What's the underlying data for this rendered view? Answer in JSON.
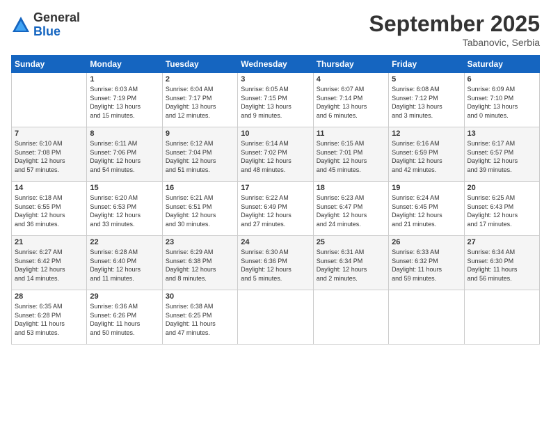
{
  "logo": {
    "general": "General",
    "blue": "Blue"
  },
  "title": "September 2025",
  "location": "Tabanovic, Serbia",
  "days_of_week": [
    "Sunday",
    "Monday",
    "Tuesday",
    "Wednesday",
    "Thursday",
    "Friday",
    "Saturday"
  ],
  "weeks": [
    [
      {
        "day": "",
        "info": ""
      },
      {
        "day": "1",
        "info": "Sunrise: 6:03 AM\nSunset: 7:19 PM\nDaylight: 13 hours\nand 15 minutes."
      },
      {
        "day": "2",
        "info": "Sunrise: 6:04 AM\nSunset: 7:17 PM\nDaylight: 13 hours\nand 12 minutes."
      },
      {
        "day": "3",
        "info": "Sunrise: 6:05 AM\nSunset: 7:15 PM\nDaylight: 13 hours\nand 9 minutes."
      },
      {
        "day": "4",
        "info": "Sunrise: 6:07 AM\nSunset: 7:14 PM\nDaylight: 13 hours\nand 6 minutes."
      },
      {
        "day": "5",
        "info": "Sunrise: 6:08 AM\nSunset: 7:12 PM\nDaylight: 13 hours\nand 3 minutes."
      },
      {
        "day": "6",
        "info": "Sunrise: 6:09 AM\nSunset: 7:10 PM\nDaylight: 13 hours\nand 0 minutes."
      }
    ],
    [
      {
        "day": "7",
        "info": "Sunrise: 6:10 AM\nSunset: 7:08 PM\nDaylight: 12 hours\nand 57 minutes."
      },
      {
        "day": "8",
        "info": "Sunrise: 6:11 AM\nSunset: 7:06 PM\nDaylight: 12 hours\nand 54 minutes."
      },
      {
        "day": "9",
        "info": "Sunrise: 6:12 AM\nSunset: 7:04 PM\nDaylight: 12 hours\nand 51 minutes."
      },
      {
        "day": "10",
        "info": "Sunrise: 6:14 AM\nSunset: 7:02 PM\nDaylight: 12 hours\nand 48 minutes."
      },
      {
        "day": "11",
        "info": "Sunrise: 6:15 AM\nSunset: 7:01 PM\nDaylight: 12 hours\nand 45 minutes."
      },
      {
        "day": "12",
        "info": "Sunrise: 6:16 AM\nSunset: 6:59 PM\nDaylight: 12 hours\nand 42 minutes."
      },
      {
        "day": "13",
        "info": "Sunrise: 6:17 AM\nSunset: 6:57 PM\nDaylight: 12 hours\nand 39 minutes."
      }
    ],
    [
      {
        "day": "14",
        "info": "Sunrise: 6:18 AM\nSunset: 6:55 PM\nDaylight: 12 hours\nand 36 minutes."
      },
      {
        "day": "15",
        "info": "Sunrise: 6:20 AM\nSunset: 6:53 PM\nDaylight: 12 hours\nand 33 minutes."
      },
      {
        "day": "16",
        "info": "Sunrise: 6:21 AM\nSunset: 6:51 PM\nDaylight: 12 hours\nand 30 minutes."
      },
      {
        "day": "17",
        "info": "Sunrise: 6:22 AM\nSunset: 6:49 PM\nDaylight: 12 hours\nand 27 minutes."
      },
      {
        "day": "18",
        "info": "Sunrise: 6:23 AM\nSunset: 6:47 PM\nDaylight: 12 hours\nand 24 minutes."
      },
      {
        "day": "19",
        "info": "Sunrise: 6:24 AM\nSunset: 6:45 PM\nDaylight: 12 hours\nand 21 minutes."
      },
      {
        "day": "20",
        "info": "Sunrise: 6:25 AM\nSunset: 6:43 PM\nDaylight: 12 hours\nand 17 minutes."
      }
    ],
    [
      {
        "day": "21",
        "info": "Sunrise: 6:27 AM\nSunset: 6:42 PM\nDaylight: 12 hours\nand 14 minutes."
      },
      {
        "day": "22",
        "info": "Sunrise: 6:28 AM\nSunset: 6:40 PM\nDaylight: 12 hours\nand 11 minutes."
      },
      {
        "day": "23",
        "info": "Sunrise: 6:29 AM\nSunset: 6:38 PM\nDaylight: 12 hours\nand 8 minutes."
      },
      {
        "day": "24",
        "info": "Sunrise: 6:30 AM\nSunset: 6:36 PM\nDaylight: 12 hours\nand 5 minutes."
      },
      {
        "day": "25",
        "info": "Sunrise: 6:31 AM\nSunset: 6:34 PM\nDaylight: 12 hours\nand 2 minutes."
      },
      {
        "day": "26",
        "info": "Sunrise: 6:33 AM\nSunset: 6:32 PM\nDaylight: 11 hours\nand 59 minutes."
      },
      {
        "day": "27",
        "info": "Sunrise: 6:34 AM\nSunset: 6:30 PM\nDaylight: 11 hours\nand 56 minutes."
      }
    ],
    [
      {
        "day": "28",
        "info": "Sunrise: 6:35 AM\nSunset: 6:28 PM\nDaylight: 11 hours\nand 53 minutes."
      },
      {
        "day": "29",
        "info": "Sunrise: 6:36 AM\nSunset: 6:26 PM\nDaylight: 11 hours\nand 50 minutes."
      },
      {
        "day": "30",
        "info": "Sunrise: 6:38 AM\nSunset: 6:25 PM\nDaylight: 11 hours\nand 47 minutes."
      },
      {
        "day": "",
        "info": ""
      },
      {
        "day": "",
        "info": ""
      },
      {
        "day": "",
        "info": ""
      },
      {
        "day": "",
        "info": ""
      }
    ]
  ]
}
